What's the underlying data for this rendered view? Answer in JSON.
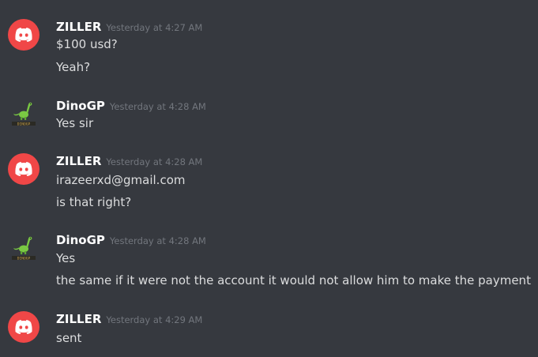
{
  "messages": [
    {
      "author": "ZILLER",
      "avatar": "discord-logo-icon",
      "timestamp": "Yesterday at 4:27 AM",
      "lines": [
        "$100 usd?",
        "Yeah?"
      ]
    },
    {
      "author": "DinoGP",
      "avatar": "dinosaur-icon",
      "timestamp": "Yesterday at 4:28 AM",
      "lines": [
        "Yes sir"
      ]
    },
    {
      "author": "ZILLER",
      "avatar": "discord-logo-icon",
      "timestamp": "Yesterday at 4:28 AM",
      "lines": [
        "irazeerxd@gmail.com",
        "is that right?"
      ]
    },
    {
      "author": "DinoGP",
      "avatar": "dinosaur-icon",
      "timestamp": "Yesterday at 4:28 AM",
      "lines": [
        "Yes",
        "the same if it were not the account it would not allow him to make the payment"
      ]
    },
    {
      "author": "ZILLER",
      "avatar": "discord-logo-icon",
      "timestamp": "Yesterday at 4:29 AM",
      "lines": [
        "sent"
      ]
    }
  ],
  "colors": {
    "background": "#36393f",
    "discord_avatar": "#f04747",
    "username": "#ffffff",
    "timestamp": "#72767d",
    "text": "#dcddde"
  }
}
